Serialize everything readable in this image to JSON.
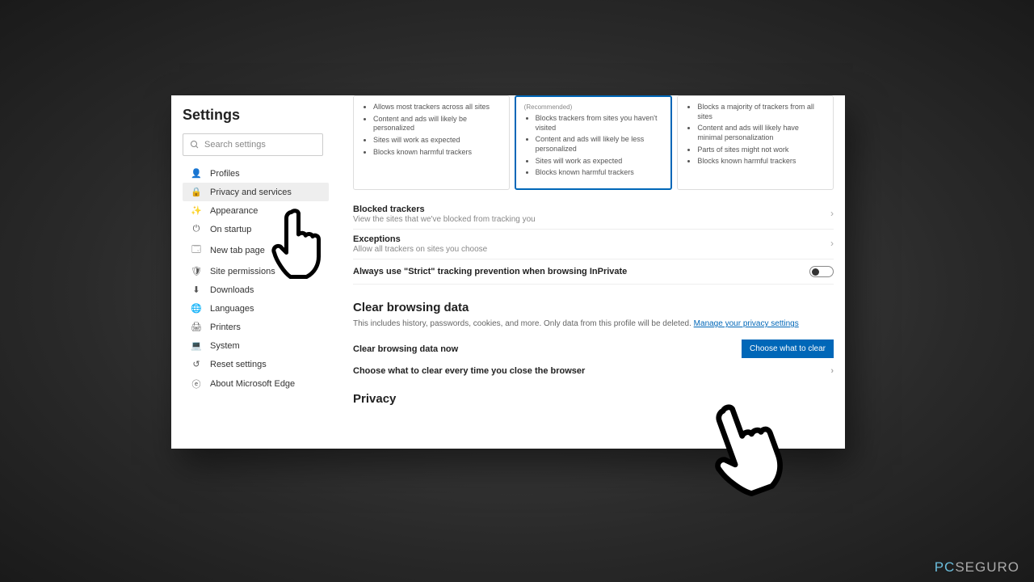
{
  "sidebar": {
    "title": "Settings",
    "search_placeholder": "Search settings",
    "items": [
      {
        "icon": "👤",
        "label": "Profiles"
      },
      {
        "icon": "🔒",
        "label": "Privacy and services"
      },
      {
        "icon": "✨",
        "label": "Appearance"
      },
      {
        "icon": "⏻",
        "label": "On startup"
      },
      {
        "icon": "🗔",
        "label": "New tab page"
      },
      {
        "icon": "🛡",
        "label": "Site permissions"
      },
      {
        "icon": "⬇",
        "label": "Downloads"
      },
      {
        "icon": "🌐",
        "label": "Languages"
      },
      {
        "icon": "🖨",
        "label": "Printers"
      },
      {
        "icon": "💻",
        "label": "System"
      },
      {
        "icon": "↺",
        "label": "Reset settings"
      },
      {
        "icon": "ⓔ",
        "label": "About Microsoft Edge"
      }
    ]
  },
  "tracking": {
    "cards": [
      {
        "rec": "",
        "bullets": [
          "Allows most trackers across all sites",
          "Content and ads will likely be personalized",
          "Sites will work as expected",
          "Blocks known harmful trackers"
        ]
      },
      {
        "rec": "(Recommended)",
        "bullets": [
          "Blocks trackers from sites you haven't visited",
          "Content and ads will likely be less personalized",
          "Sites will work as expected",
          "Blocks known harmful trackers"
        ]
      },
      {
        "rec": "",
        "bullets": [
          "Blocks a majority of trackers from all sites",
          "Content and ads will likely have minimal personalization",
          "Parts of sites might not work",
          "Blocks known harmful trackers"
        ]
      }
    ]
  },
  "blocked": {
    "title": "Blocked trackers",
    "sub": "View the sites that we've blocked from tracking you"
  },
  "exceptions": {
    "title": "Exceptions",
    "sub": "Allow all trackers on sites you choose"
  },
  "strict_toggle": "Always use \"Strict\" tracking prevention when browsing InPrivate",
  "cbd": {
    "title": "Clear browsing data",
    "desc": "This includes history, passwords, cookies, and more. Only data from this profile will be deleted. ",
    "link": "Manage your privacy settings",
    "now": "Clear browsing data now",
    "button": "Choose what to clear",
    "every": "Choose what to clear every time you close the browser"
  },
  "privacy_title": "Privacy",
  "watermark": {
    "pc": "PC",
    "seguro": "SEGURO"
  }
}
